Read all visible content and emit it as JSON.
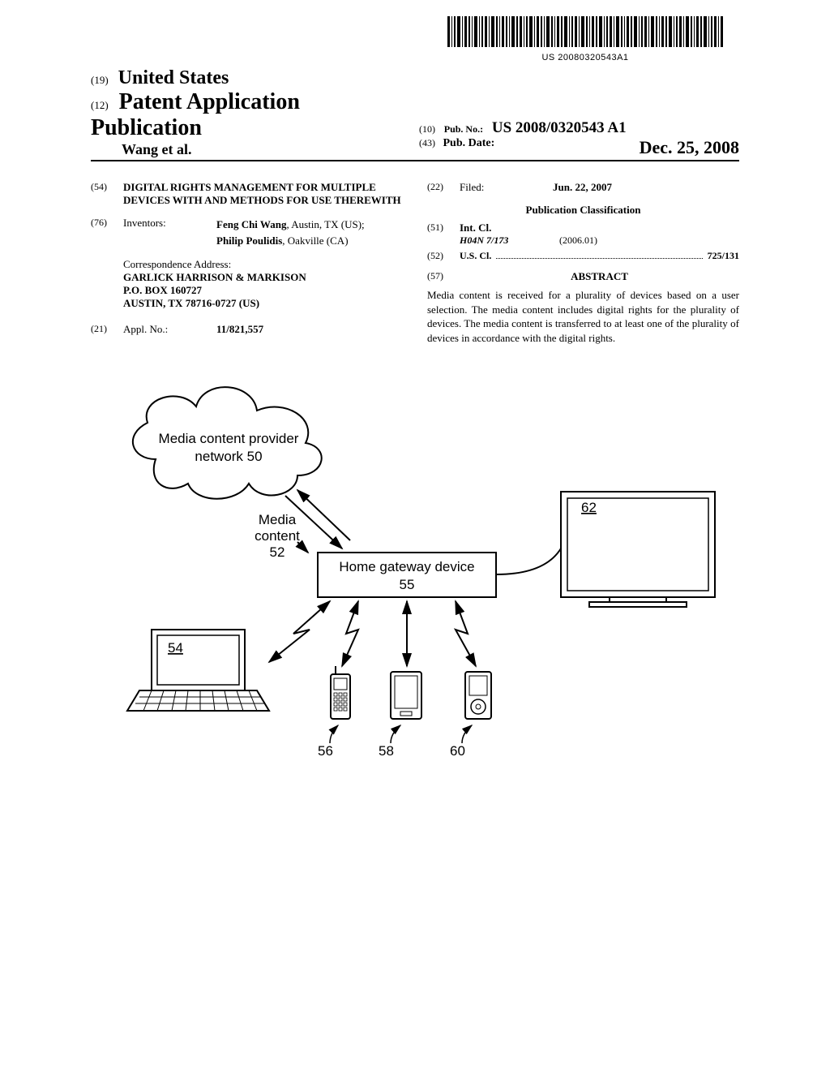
{
  "barcode_text": "US 20080320543A1",
  "header": {
    "code19": "(19)",
    "country": "United States",
    "code12": "(12)",
    "doc_type": "Patent Application Publication",
    "authors": "Wang et al.",
    "code10": "(10)",
    "pubno_label": "Pub. No.:",
    "pubno": "US 2008/0320543 A1",
    "code43": "(43)",
    "pubdate_label": "Pub. Date:",
    "pubdate": "Dec. 25, 2008"
  },
  "left": {
    "code54": "(54)",
    "title": "DIGITAL RIGHTS MANAGEMENT FOR MULTIPLE DEVICES WITH AND METHODS FOR USE THEREWITH",
    "code76": "(76)",
    "inventors_label": "Inventors:",
    "inventor1_name": "Feng Chi Wang",
    "inventor1_loc": ", Austin, TX (US);",
    "inventor2_name": "Philip Poulidis",
    "inventor2_loc": ", Oakville (CA)",
    "corr_label": "Correspondence Address:",
    "corr_line1": "GARLICK HARRISON & MARKISON",
    "corr_line2": "P.O. BOX 160727",
    "corr_line3": "AUSTIN, TX 78716-0727 (US)",
    "code21": "(21)",
    "applno_label": "Appl. No.:",
    "applno": "11/821,557"
  },
  "right": {
    "code22": "(22)",
    "filed_label": "Filed:",
    "filed": "Jun. 22, 2007",
    "pubclass_heading": "Publication Classification",
    "code51": "(51)",
    "intcl_label": "Int. Cl.",
    "intcl_code": "H04N  7/173",
    "intcl_date": "(2006.01)",
    "code52": "(52)",
    "uscl_label": "U.S. Cl.",
    "uscl_value": "725/131",
    "code57": "(57)",
    "abstract_heading": "ABSTRACT",
    "abstract_text": "Media content is received for a plurality of devices based on a user selection. The media content includes digital rights for the plurality of devices. The media content is transferred to at least one of the plurality of devices in accordance with the digital rights."
  },
  "figure": {
    "cloud_label1": "Media content provider",
    "cloud_label2": "network 50",
    "media_label1": "Media",
    "media_label2": "content",
    "media_label3": "52",
    "gateway_label1": "Home gateway device",
    "gateway_label2": "55",
    "laptop_label": "54",
    "phone_label": "56",
    "pda_label": "58",
    "mp3_label": "60",
    "tv_label": "62"
  }
}
